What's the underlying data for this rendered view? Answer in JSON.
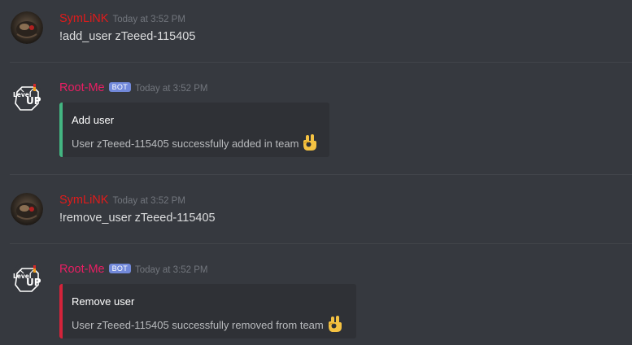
{
  "colors": {
    "background": "#36393f",
    "embed_bg": "#2f3136",
    "add_bar": "#43b581",
    "remove_bar": "#d4233a",
    "symlink_name": "#e01b1b",
    "rootme_name": "#e91e63",
    "bot_tag": "#7289da"
  },
  "messages": [
    {
      "author": "SymLiNK",
      "timestamp": "Today at 3:52 PM",
      "text": "!add_user zTeeed-115405"
    },
    {
      "author": "Root-Me",
      "bot_tag": "BOT",
      "timestamp": "Today at 3:52 PM",
      "embed": {
        "title": "Add user",
        "description": "User zTeeed-115405 successfully added in team",
        "emoji": "ok-hand-icon"
      }
    },
    {
      "author": "SymLiNK",
      "timestamp": "Today at 3:52 PM",
      "text": "!remove_user zTeeed-115405"
    },
    {
      "author": "Root-Me",
      "bot_tag": "BOT",
      "timestamp": "Today at 3:52 PM",
      "embed": {
        "title": "Remove user",
        "description": "User zTeeed-115405 successfully removed from team",
        "emoji": "ok-hand-icon"
      }
    }
  ],
  "avatars": {
    "rootme_text_top": "Level",
    "rootme_text_bottom": "UP"
  }
}
